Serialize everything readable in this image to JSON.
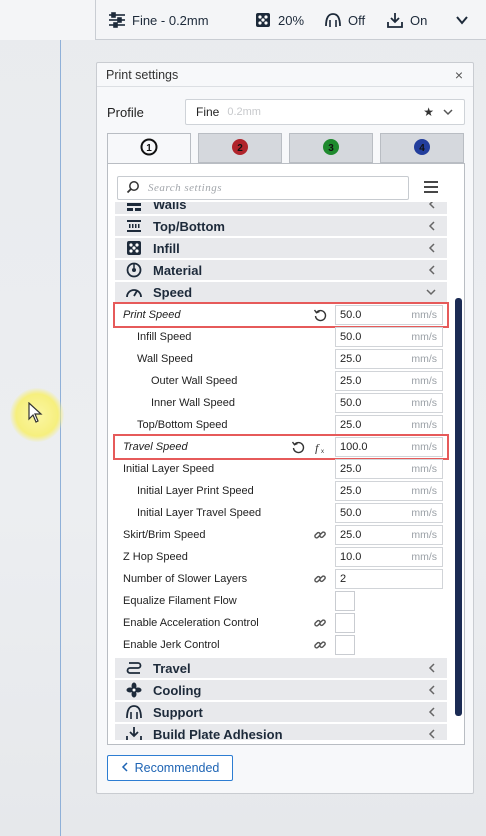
{
  "toolbar": {
    "profile": "Fine - 0.2mm",
    "infill": "20%",
    "support": "Off",
    "adhesion": "On"
  },
  "panel": {
    "title": "Print settings",
    "close": "×"
  },
  "profile": {
    "label": "Profile",
    "name": "Fine",
    "sub": "0.2mm"
  },
  "tabs": [
    {
      "label": "1",
      "color": "#111111"
    },
    {
      "label": "2",
      "color": "#b0242b"
    },
    {
      "label": "3",
      "color": "#1f8a2e"
    },
    {
      "label": "4",
      "color": "#233e9c"
    }
  ],
  "search": {
    "placeholder": "Search settings"
  },
  "categories": {
    "walls": "Walls",
    "top_bottom": "Top/Bottom",
    "infill": "Infill",
    "material": "Material",
    "speed": "Speed",
    "travel": "Travel",
    "cooling": "Cooling",
    "support": "Support",
    "adhesion": "Build Plate Adhesion"
  },
  "rows": [
    {
      "label": "Print Speed",
      "value": "50.0",
      "unit": "mm/s"
    },
    {
      "label": "Infill Speed",
      "value": "50.0",
      "unit": "mm/s"
    },
    {
      "label": "Wall Speed",
      "value": "25.0",
      "unit": "mm/s"
    },
    {
      "label": "Outer Wall Speed",
      "value": "25.0",
      "unit": "mm/s"
    },
    {
      "label": "Inner Wall Speed",
      "value": "50.0",
      "unit": "mm/s"
    },
    {
      "label": "Top/Bottom Speed",
      "value": "25.0",
      "unit": "mm/s"
    },
    {
      "label": "Travel Speed",
      "value": "100.0",
      "unit": "mm/s"
    },
    {
      "label": "Initial Layer Speed",
      "value": "25.0",
      "unit": "mm/s"
    },
    {
      "label": "Initial Layer Print Speed",
      "value": "25.0",
      "unit": "mm/s"
    },
    {
      "label": "Initial Layer Travel Speed",
      "value": "50.0",
      "unit": "mm/s"
    },
    {
      "label": "Skirt/Brim Speed",
      "value": "25.0",
      "unit": "mm/s"
    },
    {
      "label": "Z Hop Speed",
      "value": "10.0",
      "unit": "mm/s"
    },
    {
      "label": "Number of Slower Layers",
      "value": "2",
      "unit": ""
    },
    {
      "label": "Equalize Filament Flow",
      "value": "",
      "unit": ""
    },
    {
      "label": "Enable Acceleration Control",
      "value": "",
      "unit": ""
    },
    {
      "label": "Enable Jerk Control",
      "value": "",
      "unit": ""
    }
  ],
  "recommended": "Recommended"
}
